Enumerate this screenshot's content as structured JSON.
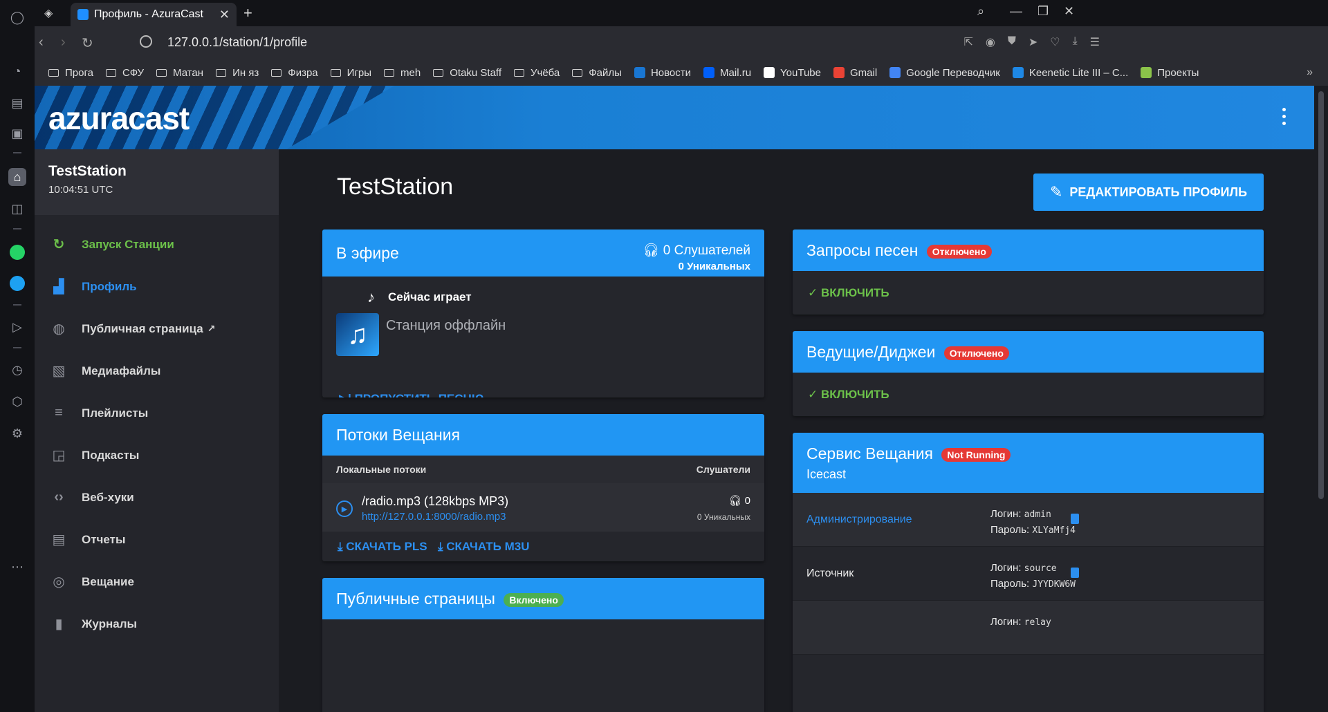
{
  "browser": {
    "tab_title": "Профиль - AzuraCast",
    "url": "127.0.0.1/station/1/profile",
    "bookmarks": [
      {
        "label": "Прога",
        "type": "folder"
      },
      {
        "label": "СФУ",
        "type": "folder"
      },
      {
        "label": "Матан",
        "type": "folder"
      },
      {
        "label": "Ин яз",
        "type": "folder"
      },
      {
        "label": "Физра",
        "type": "folder"
      },
      {
        "label": "Игры",
        "type": "folder"
      },
      {
        "label": "meh",
        "type": "folder"
      },
      {
        "label": "Otaku Staff",
        "type": "folder"
      },
      {
        "label": "Учёба",
        "type": "folder"
      },
      {
        "label": "Файлы",
        "type": "folder"
      },
      {
        "label": "Новости",
        "type": "site",
        "color": "#1976d2"
      },
      {
        "label": "Mail.ru",
        "type": "site",
        "color": "#005ff9"
      },
      {
        "label": "YouTube",
        "type": "site",
        "color": "#ffffff"
      },
      {
        "label": "Gmail",
        "type": "site",
        "color": "#ea4335"
      },
      {
        "label": "Google Переводчик",
        "type": "site",
        "color": "#4285f4"
      },
      {
        "label": "Keenetic Lite III – С...",
        "type": "site",
        "color": "#1e88e5"
      },
      {
        "label": "Проекты",
        "type": "site",
        "color": "#8bc34a"
      }
    ]
  },
  "app": {
    "logo": "azuracast",
    "colors": {
      "primary": "#2196f3",
      "success": "#6cc04a",
      "danger": "#e53935"
    }
  },
  "sidebar": {
    "station_name": "TestStation",
    "station_time": "10:04:51 UTC",
    "items": [
      {
        "label": "Запуск Станции",
        "icon": "restart-icon"
      },
      {
        "label": "Профиль",
        "icon": "profile-icon"
      },
      {
        "label": "Публичная страница",
        "icon": "globe-icon"
      },
      {
        "label": "Медиафайлы",
        "icon": "media-icon"
      },
      {
        "label": "Плейлисты",
        "icon": "playlist-icon"
      },
      {
        "label": "Подкасты",
        "icon": "podcast-icon"
      },
      {
        "label": "Веб-хуки",
        "icon": "code-icon"
      },
      {
        "label": "Отчеты",
        "icon": "report-icon"
      },
      {
        "label": "Вещание",
        "icon": "broadcast-icon"
      },
      {
        "label": "Журналы",
        "icon": "logs-icon"
      }
    ]
  },
  "main": {
    "title": "TestStation",
    "edit_button": "РЕДАКТИРОВАТЬ ПРОФИЛЬ",
    "on_air": {
      "title": "В эфире",
      "listeners": "0 Слушателей",
      "unique": "0 Уникальных",
      "now_playing_label": "Сейчас играет",
      "song": "Станция оффлайн",
      "skip": "ПРОПУСТИТЬ ПЕСНЮ"
    },
    "streams": {
      "title": "Потоки Вещания",
      "col_local": "Локальные потоки",
      "col_listeners": "Слушатели",
      "rows": [
        {
          "name": "/radio.mp3 (128kbps MP3)",
          "url": "http://127.0.0.1:8000/radio.mp3",
          "listeners": "0",
          "unique": "0 Уникальных"
        }
      ],
      "download_pls": "СКАЧАТЬ PLS",
      "download_m3u": "СКАЧАТЬ M3U"
    },
    "public_pages": {
      "title": "Публичные страницы",
      "badge": "Включено"
    },
    "requests": {
      "title": "Запросы песен",
      "badge": "Отключено",
      "enable": "ВКЛЮЧИТЬ"
    },
    "djs": {
      "title": "Ведущие/Диджеи",
      "badge": "Отключено",
      "enable": "ВКЛЮЧИТЬ"
    },
    "service": {
      "title": "Сервис Вещания",
      "badge": "Not Running",
      "subtitle": "Icecast",
      "rows": [
        {
          "label": "Администрирование",
          "login_label": "Логин:",
          "login": "admin",
          "password_label": "Пароль:",
          "password": "XLYaMfj4"
        },
        {
          "label": "Источник",
          "login_label": "Логин:",
          "login": "source",
          "password_label": "Пароль:",
          "password": "JYYDKW6W"
        },
        {
          "label": "",
          "login_label": "Логин:",
          "login": "relay",
          "password_label": "",
          "password": ""
        }
      ]
    }
  }
}
